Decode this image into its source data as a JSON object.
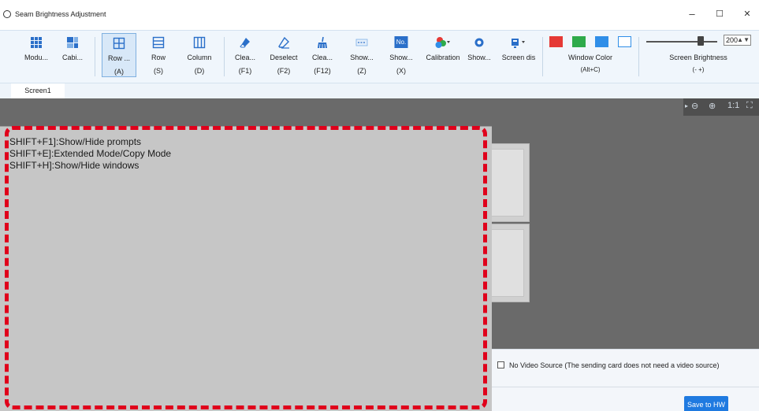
{
  "window": {
    "title": "Seam Brightness Adjustment",
    "minimize": "–",
    "maximize": "☐",
    "close": "✕"
  },
  "toolbar": {
    "tools": [
      {
        "label": "Modu...",
        "key": "",
        "icon": "module-grid-icon"
      },
      {
        "label": "Cabi...",
        "key": "",
        "icon": "cabinet-icon"
      },
      {
        "label": "Row ...",
        "key": "(A)",
        "icon": "row-column-grid-icon"
      },
      {
        "label": "Row",
        "key": "(S)",
        "icon": "row-icon"
      },
      {
        "label": "Column",
        "key": "(D)",
        "icon": "column-icon"
      },
      {
        "label": "Clea...",
        "key": "(F1)",
        "icon": "eraser-icon"
      },
      {
        "label": "Deselect",
        "key": "(F2)",
        "icon": "deselect-eraser-icon"
      },
      {
        "label": "Clea...",
        "key": "(F12)",
        "icon": "broom-icon"
      },
      {
        "label": "Show...",
        "key": "(Z)",
        "icon": "show-dashed-icon"
      },
      {
        "label": "Show...",
        "key": "(X)",
        "icon": "number-icon"
      },
      {
        "label": "Calibration",
        "key": "",
        "icon": "calibration-palette-icon"
      },
      {
        "label": "Show...",
        "key": "",
        "icon": "eye-icon"
      },
      {
        "label": "Screen dis",
        "key": "",
        "icon": "screen-display-icon"
      }
    ],
    "number_icon_text": "No.",
    "window_color": {
      "label": "Window Color",
      "key": "(Alt+C)",
      "colors": [
        "#e53935",
        "#2eaa4a",
        "#2f8ee8",
        "#ffffff"
      ]
    },
    "screen_brightness": {
      "label": "Screen Brightness",
      "key": "(-  +)",
      "value": "200",
      "spin": "▲▼",
      "level": 0.85
    }
  },
  "tabs": [
    {
      "label": "Screen1"
    }
  ],
  "zoom": {
    "zoom_out": "⊖",
    "zoom_in": "⊕",
    "ratio": "1:1",
    "fit": "⛶"
  },
  "prompts": {
    "lines": [
      "SHIFT+F1]:Show/Hide prompts",
      "SHIFT+E]:Extended Mode/Copy Mode",
      "SHIFT+H]:Show/Hide windows"
    ]
  },
  "bottom": {
    "no_video_source": "No Video Source  (The sending card does not need a video source)",
    "no_video_checked": false,
    "save_button": "Save to HW"
  }
}
